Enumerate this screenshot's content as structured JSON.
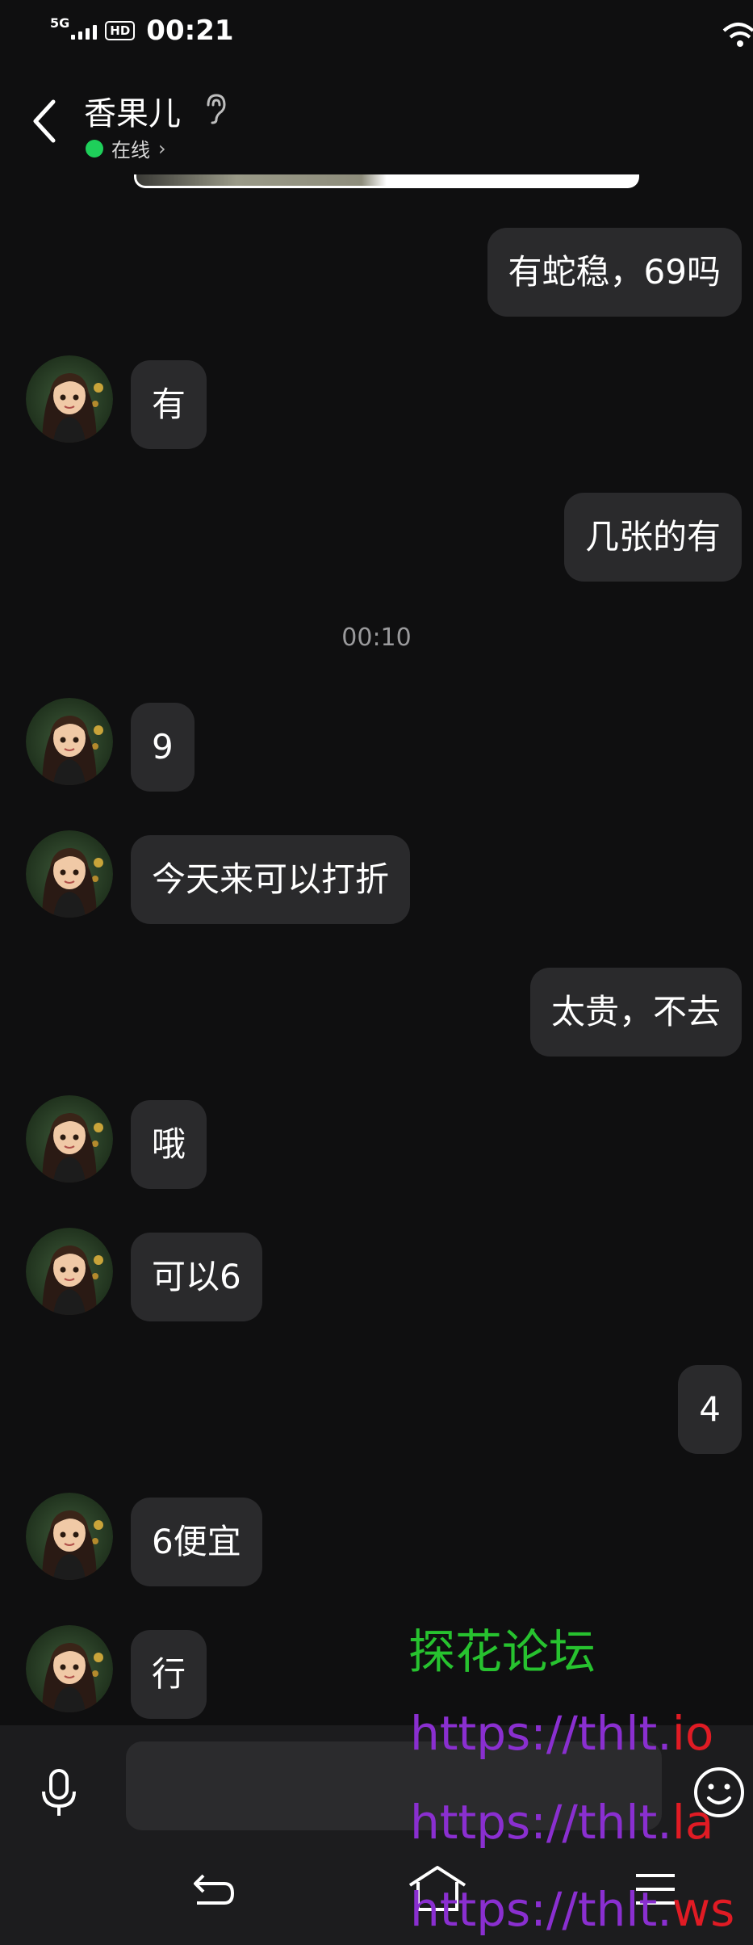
{
  "status_bar": {
    "network": "5G",
    "hd_badge": "HD",
    "time": "00:21"
  },
  "header": {
    "title": "香果儿",
    "status_text": "在线",
    "status_color": "#1ecf5a"
  },
  "colors": {
    "background": "#0f0f10",
    "bubble": "#2a2a2c",
    "input_bar": "#1c1c1e"
  },
  "messages": [
    {
      "side": "right",
      "text": "有蛇稳，69吗"
    },
    {
      "side": "left",
      "text": "有"
    },
    {
      "side": "right",
      "text": "几张的有"
    },
    {
      "side": "left",
      "text": "9"
    },
    {
      "side": "left",
      "text": "今天来可以打折"
    },
    {
      "side": "right",
      "text": "太贵，不去"
    },
    {
      "side": "left",
      "text": "哦"
    },
    {
      "side": "left",
      "text": "可以6"
    },
    {
      "side": "right",
      "text": "4"
    },
    {
      "side": "left",
      "text": "6便宜"
    },
    {
      "side": "left",
      "text": "行"
    }
  ],
  "time_separator": "00:10",
  "input": {
    "placeholder": ""
  },
  "icons": [
    "back-arrow-icon",
    "ear-icon",
    "mic-icon",
    "emoji-icon",
    "nav-back-icon",
    "nav-home-icon",
    "nav-menu-icon",
    "wifi-icon"
  ],
  "watermark": {
    "line1": "探花论坛",
    "line2_a": "https://thlt.",
    "line2_b": "io",
    "line3_a": "https://thlt.",
    "line3_b": "la",
    "line4_a": "https://thlt.",
    "line4_b": "ws"
  }
}
